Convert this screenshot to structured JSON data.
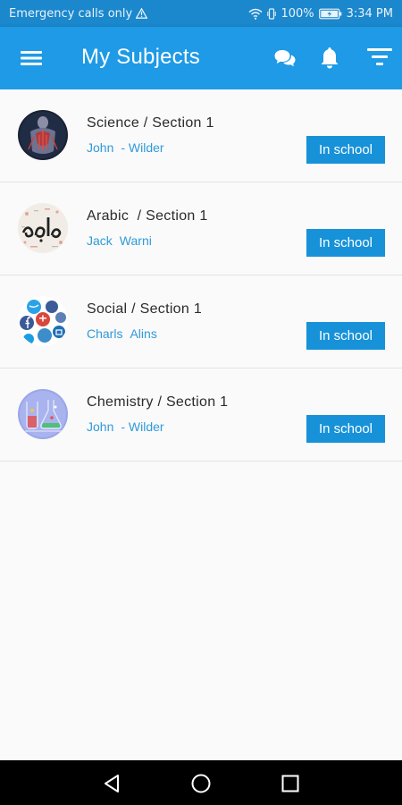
{
  "status_bar": {
    "carrier_text": "Emergency calls only",
    "battery": "100%",
    "time": "3:34 PM"
  },
  "app_bar": {
    "title": "My Subjects",
    "color": "#1e9ae6"
  },
  "subjects": [
    {
      "title": "Science / Section 1",
      "teacher_first": "John",
      "teacher_last": "- Wilder",
      "status": "In school",
      "avatar_icon": "anatomy-icon"
    },
    {
      "title": "Arabic  / Section 1",
      "teacher_first": "Jack",
      "teacher_last": "Warni",
      "status": "In school",
      "avatar_icon": "arabic-calligraphy-icon"
    },
    {
      "title": "Social / Section 1",
      "teacher_first": "Charls",
      "teacher_last": "Alins",
      "status": "In school",
      "avatar_icon": "social-media-icon"
    },
    {
      "title": "Chemistry / Section 1",
      "teacher_first": "John",
      "teacher_last": "- Wilder",
      "status": "In school",
      "avatar_icon": "chemistry-lab-icon"
    }
  ],
  "colors": {
    "accent": "#1792d9",
    "teacher_text": "#2f9ad9"
  }
}
